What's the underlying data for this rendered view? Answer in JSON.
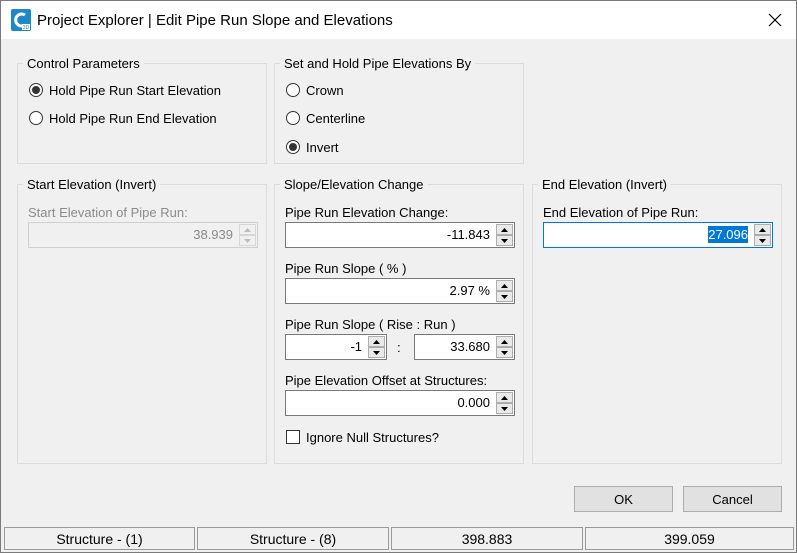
{
  "window": {
    "title": "Project Explorer | Edit Pipe Run Slope and Elevations"
  },
  "control_parameters": {
    "title": "Control Parameters",
    "options": [
      {
        "label": "Hold Pipe Run Start Elevation",
        "checked": true
      },
      {
        "label": "Hold Pipe Run End Elevation",
        "checked": false
      }
    ]
  },
  "elevations_by": {
    "title": "Set and Hold Pipe Elevations By",
    "options": [
      {
        "label": "Crown",
        "checked": false
      },
      {
        "label": "Centerline",
        "checked": false
      },
      {
        "label": "Invert",
        "checked": true
      }
    ]
  },
  "start_elevation": {
    "title": "Start Elevation (Invert)",
    "field_label": "Start Elevation of Pipe Run:",
    "value": "38.939"
  },
  "slope_change": {
    "title": "Slope/Elevation Change",
    "elevation_change_label": "Pipe Run Elevation Change:",
    "elevation_change_value": "-11.843",
    "slope_pct_label": "Pipe Run Slope ( % )",
    "slope_pct_value": "2.97 %",
    "rise_run_label": "Pipe Run Slope ( Rise : Run )",
    "rise_value": "-1",
    "ratio_separator": ":",
    "run_value": "33.680",
    "offset_label": "Pipe Elevation Offset at Structures:",
    "offset_value": "0.000",
    "ignore_null_label": "Ignore Null Structures?",
    "ignore_null_checked": false
  },
  "end_elevation": {
    "title": "End Elevation (Invert)",
    "field_label": "End Elevation of Pipe Run:",
    "value": "27.096"
  },
  "buttons": {
    "ok": "OK",
    "cancel": "Cancel"
  },
  "status_bar": [
    "Structure - (1)",
    "Structure - (8)",
    "398.883",
    "399.059"
  ],
  "colors": {
    "selection": "#0078d7",
    "icon": "#1e88c8"
  }
}
